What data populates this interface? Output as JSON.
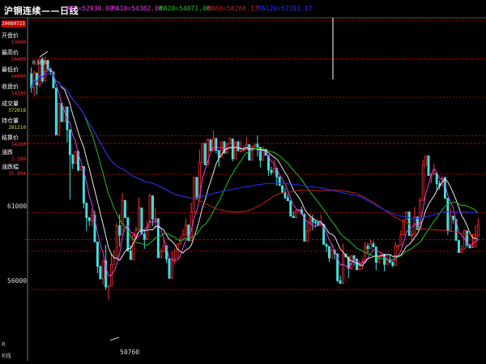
{
  "window": {
    "title": "沪铜连续——日线",
    "bottom_left_a": "R",
    "bottom_left_b": "K线"
  },
  "ma_legend": [
    {
      "label": "MA5=52930.00",
      "color": "#e040e0"
    },
    {
      "label": "MA10=54382.00",
      "color": "#e040e0"
    },
    {
      "label": "MA20=54071.00",
      "color": "#20c020"
    },
    {
      "label": "MA60=58266.17",
      "color": "#c02020"
    },
    {
      "label": "MA120=57183.17",
      "color": "#2030ff"
    }
  ],
  "info_panel": {
    "date": "20080723",
    "items": [
      {
        "label": "开盘价",
        "value": "53000",
        "color": "#ff3030"
      },
      {
        "label": "最高价",
        "value": "54400",
        "color": "#ff3030"
      },
      {
        "label": "最低价",
        "value": "54000",
        "color": "#ff3030"
      },
      {
        "label": "收盘价",
        "value": "54200",
        "color": "#ff3030"
      },
      {
        "label": "成交量",
        "value": "372018",
        "color": "#e0e030"
      },
      {
        "label": "持仓量",
        "value": "281210",
        "color": "#e0e030"
      },
      {
        "label": "结算价",
        "value": "54200",
        "color": "#ff3030"
      },
      {
        "label": "涨跌",
        "value": "1.180",
        "color": "#ff3030"
      },
      {
        "label": "涨跌幅",
        "value": "15.994",
        "color": "#ff3030"
      }
    ]
  },
  "chart_data": {
    "type": "candlestick",
    "y_ticks": [
      {
        "label": "61000",
        "value": 61000
      },
      {
        "label": "56000",
        "value": 56000
      }
    ],
    "ylim": [
      50000,
      67400
    ],
    "peak_label": "63880",
    "min_label": "50760",
    "min_value": 50760,
    "colors": {
      "up": "#ff3030",
      "down": "#40e0e0",
      "grid": "#b00000"
    },
    "candles": [
      [
        64620,
        63900,
        64950,
        63640
      ],
      [
        63900,
        64660,
        64800,
        63460
      ],
      [
        64660,
        64040,
        64440,
        63540
      ],
      [
        64040,
        65390,
        65150,
        63940
      ],
      [
        65390,
        64250,
        65490,
        64130
      ],
      [
        64250,
        65310,
        65510,
        64390
      ],
      [
        65310,
        64870,
        65110,
        64760
      ],
      [
        64870,
        64720,
        64930,
        64540
      ],
      [
        64720,
        63880,
        64240,
        63860
      ],
      [
        63880,
        61440,
        62320,
        61630
      ],
      [
        61440,
        63080,
        62900,
        61390
      ],
      [
        63080,
        62130,
        63010,
        62220
      ],
      [
        62130,
        62900,
        62910,
        62230
      ],
      [
        62900,
        61710,
        61730,
        61060
      ],
      [
        61710,
        60410,
        60430,
        58080
      ],
      [
        60410,
        59960,
        59670,
        60350
      ],
      [
        59960,
        60570,
        60620,
        60120
      ],
      [
        60570,
        59610,
        60640,
        59540
      ],
      [
        59610,
        59800,
        59600,
        59590
      ],
      [
        59800,
        57900,
        58100,
        57630
      ],
      [
        57900,
        57140,
        57630,
        56450
      ],
      [
        57140,
        56990,
        56900,
        56710
      ],
      [
        56990,
        57260,
        56720,
        57570
      ],
      [
        57260,
        55880,
        57500,
        56460
      ],
      [
        55880,
        54610,
        55220,
        54250
      ],
      [
        54610,
        53960,
        53940,
        54070
      ],
      [
        53960,
        54900,
        54720,
        53640
      ],
      [
        54900,
        53540,
        55730,
        53390
      ],
      [
        53540,
        53600,
        52880,
        53440
      ],
      [
        53600,
        54710,
        55250,
        54680
      ],
      [
        54710,
        55060,
        55090,
        55470
      ],
      [
        55060,
        56730,
        55840,
        56850
      ],
      [
        56730,
        56230,
        57310,
        55630
      ],
      [
        56230,
        58040,
        58430,
        57740
      ],
      [
        58040,
        57140,
        57500,
        57680
      ],
      [
        57140,
        55410,
        56880,
        55820
      ],
      [
        55410,
        54960,
        55140,
        55710
      ],
      [
        54960,
        56260,
        56040,
        56040
      ],
      [
        56260,
        56510,
        55950,
        56670
      ],
      [
        56510,
        57650,
        58170,
        57260
      ],
      [
        57650,
        56280,
        56440,
        56380
      ],
      [
        56280,
        56010,
        56550,
        55520
      ],
      [
        56010,
        56650,
        56780,
        56990
      ],
      [
        56650,
        58280,
        57820,
        58400
      ],
      [
        58280,
        57070,
        56940,
        56710
      ],
      [
        57070,
        57090,
        57650,
        56590
      ],
      [
        57090,
        55060,
        55350,
        55260
      ],
      [
        55060,
        55380,
        55180,
        55550
      ],
      [
        55380,
        55680,
        56110,
        55760
      ],
      [
        55680,
        55000,
        55560,
        54800
      ],
      [
        55000,
        53990,
        54950,
        54050
      ],
      [
        53990,
        54890,
        54640,
        55410
      ],
      [
        54890,
        55050,
        55510,
        54700
      ],
      [
        55050,
        55770,
        55470,
        55270
      ],
      [
        55770,
        55980,
        56080,
        56170
      ],
      [
        55980,
        56260,
        56500,
        56560
      ],
      [
        56260,
        56770,
        57100,
        56900
      ],
      [
        56770,
        55940,
        56240,
        56570
      ],
      [
        55940,
        57440,
        57920,
        57060
      ],
      [
        57440,
        59240,
        58830,
        59140
      ],
      [
        59240,
        58160,
        58580,
        58050
      ],
      [
        58160,
        60000,
        60670,
        59790
      ],
      [
        60000,
        61000,
        60580,
        60930
      ],
      [
        61000,
        59880,
        60430,
        60090
      ],
      [
        59880,
        61200,
        61250,
        60890
      ],
      [
        61200,
        60610,
        61130,
        60840
      ],
      [
        60610,
        61260,
        61660,
        61410
      ],
      [
        61260,
        60640,
        61310,
        60480
      ],
      [
        60640,
        60270,
        59780,
        60290
      ],
      [
        60270,
        61090,
        60880,
        60810
      ],
      [
        61090,
        60490,
        61030,
        60570
      ],
      [
        60490,
        60980,
        60800,
        60850
      ],
      [
        60980,
        61240,
        60960,
        61330
      ],
      [
        61240,
        60200,
        60070,
        60700
      ],
      [
        60200,
        61070,
        61140,
        60640
      ],
      [
        61070,
        60610,
        61160,
        60660
      ],
      [
        60610,
        60610,
        60580,
        61130
      ],
      [
        60610,
        60690,
        60760,
        60900
      ],
      [
        60690,
        60940,
        61340,
        60780
      ],
      [
        60940,
        60130,
        60270,
        60320
      ],
      [
        60130,
        60850,
        60600,
        60510
      ],
      [
        60850,
        60960,
        60960,
        60770
      ],
      [
        60960,
        60810,
        61410,
        60320
      ],
      [
        60810,
        60120,
        59750,
        60440
      ],
      [
        60120,
        60700,
        60860,
        60650
      ],
      [
        60700,
        60380,
        60560,
        60710
      ],
      [
        60380,
        59610,
        59310,
        59450
      ],
      [
        59610,
        59480,
        59790,
        59350
      ],
      [
        59480,
        59710,
        59510,
        60160
      ],
      [
        59710,
        59260,
        58810,
        59530
      ],
      [
        59260,
        58810,
        59100,
        59180
      ],
      [
        58810,
        58460,
        58380,
        58460
      ],
      [
        58460,
        58180,
        58680,
        58090
      ],
      [
        58180,
        58020,
        58110,
        58370
      ],
      [
        58020,
        57220,
        57420,
        57370
      ],
      [
        57220,
        57140,
        57130,
        57470
      ],
      [
        57140,
        57520,
        57430,
        57550
      ],
      [
        57520,
        57560,
        57530,
        57560
      ],
      [
        57560,
        57330,
        57720,
        57460
      ],
      [
        57330,
        55920,
        56030,
        56280
      ],
      [
        55920,
        56450,
        56910,
        56230
      ],
      [
        56450,
        57100,
        57380,
        57140
      ],
      [
        57100,
        56910,
        57310,
        56480
      ],
      [
        56910,
        56900,
        56630,
        57000
      ],
      [
        56900,
        56730,
        56790,
        56760
      ],
      [
        56730,
        56800,
        57290,
        56800
      ],
      [
        56800,
        55750,
        56150,
        56190
      ],
      [
        55750,
        55650,
        55830,
        55340
      ],
      [
        55650,
        55050,
        54830,
        55220
      ],
      [
        55050,
        55460,
        55300,
        55800
      ],
      [
        55460,
        55270,
        55340,
        54970
      ],
      [
        55270,
        53870,
        53780,
        54330
      ],
      [
        53870,
        53720,
        54010,
        54130
      ],
      [
        53720,
        55250,
        55790,
        54820
      ],
      [
        55250,
        55100,
        55100,
        55270
      ],
      [
        55100,
        54490,
        54860,
        54010
      ],
      [
        54490,
        55170,
        55080,
        54690
      ],
      [
        55170,
        55000,
        54620,
        54880
      ],
      [
        55000,
        54440,
        54630,
        54840
      ],
      [
        54440,
        54660,
        54950,
        54400
      ],
      [
        54660,
        54800,
        54440,
        55040
      ],
      [
        54800,
        55660,
        55880,
        55690
      ],
      [
        55660,
        55540,
        55280,
        55830
      ],
      [
        55540,
        55780,
        56010,
        55580
      ],
      [
        55780,
        55620,
        55690,
        55930
      ],
      [
        55620,
        54820,
        54410,
        54840
      ],
      [
        54820,
        55100,
        55010,
        54850
      ],
      [
        55100,
        55250,
        55230,
        55330
      ],
      [
        55250,
        54710,
        55260,
        54360
      ],
      [
        54710,
        54960,
        55230,
        54820
      ],
      [
        54960,
        54830,
        54750,
        55250
      ],
      [
        54830,
        54660,
        54570,
        54710
      ],
      [
        54660,
        55690,
        55790,
        55890
      ],
      [
        55690,
        55710,
        55530,
        55450
      ],
      [
        55710,
        56250,
        56150,
        56490
      ],
      [
        56250,
        57030,
        56820,
        56570
      ],
      [
        57030,
        57440,
        57390,
        57070
      ],
      [
        57440,
        56210,
        56700,
        56400
      ],
      [
        56210,
        56270,
        56500,
        55950
      ],
      [
        56270,
        57180,
        57700,
        57020
      ],
      [
        57180,
        56520,
        56520,
        56880
      ],
      [
        56520,
        58040,
        57710,
        58190
      ],
      [
        58040,
        59870,
        60170,
        59700
      ],
      [
        59870,
        60360,
        60300,
        60120
      ],
      [
        60360,
        59330,
        59680,
        59500
      ],
      [
        59330,
        59420,
        58930,
        59330
      ],
      [
        59420,
        59450,
        59920,
        59790
      ],
      [
        59450,
        58910,
        58680,
        58540
      ],
      [
        58910,
        58790,
        58610,
        59080
      ],
      [
        58790,
        59230,
        59100,
        58910
      ],
      [
        59230,
        58150,
        58550,
        58220
      ],
      [
        58150,
        56470,
        56240,
        56760
      ],
      [
        56470,
        57230,
        57610,
        57560
      ],
      [
        57230,
        57050,
        57240,
        56840
      ],
      [
        57050,
        55960,
        55940,
        56380
      ],
      [
        55960,
        55330,
        55870,
        55490
      ],
      [
        55330,
        55510,
        55700,
        55670
      ],
      [
        55510,
        56460,
        56310,
        56530
      ],
      [
        56460,
        55720,
        55790,
        55590
      ],
      [
        55720,
        55580,
        55530,
        55540
      ],
      [
        55580,
        55630,
        56310,
        55560
      ],
      [
        55630,
        56150,
        56750,
        56100
      ],
      [
        56150,
        56770,
        56580,
        57130
      ]
    ]
  }
}
